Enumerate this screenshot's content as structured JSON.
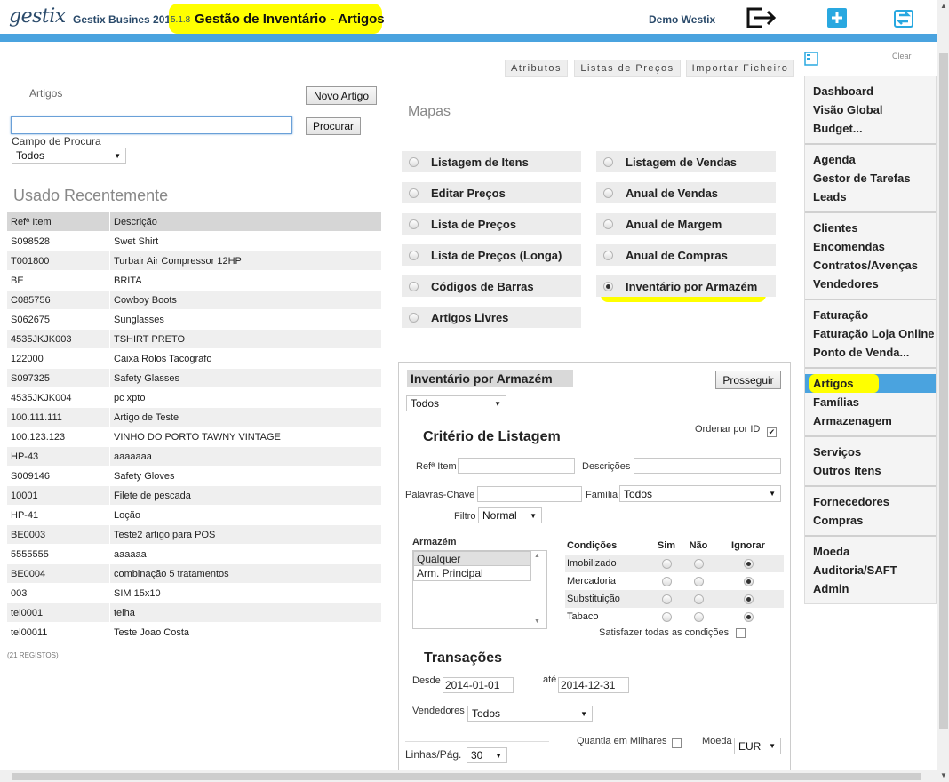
{
  "header": {
    "logo": "gestix",
    "app_name": "Gestix Busines 2014",
    "version": "5.1.8",
    "page_title": "Gestão de Inventário - Artigos",
    "user": "Demo Westix",
    "icons": [
      "logout-icon",
      "add-icon",
      "refresh-icon"
    ]
  },
  "tabs": [
    "Atributos",
    "Listas de Preços",
    "Importar Ficheiro"
  ],
  "search": {
    "section_label": "Artigos",
    "new_button": "Novo Artigo",
    "input_value": "",
    "search_button": "Procurar",
    "field_label": "Campo de Procura",
    "field_value": "Todos"
  },
  "recent": {
    "title": "Usado Recentemente",
    "columns": [
      "Refª Item",
      "Descrição"
    ],
    "rows": [
      [
        "S098528",
        "Swet Shirt"
      ],
      [
        "T001800",
        "Turbair Air Compressor 12HP"
      ],
      [
        "BE",
        "BRITA"
      ],
      [
        "C085756",
        "Cowboy Boots"
      ],
      [
        "S062675",
        "Sunglasses"
      ],
      [
        "4535JKJK003",
        "TSHIRT PRETO"
      ],
      [
        "122000",
        "Caixa Rolos Tacografo"
      ],
      [
        "S097325",
        "Safety Glasses"
      ],
      [
        "4535JKJK004",
        "pc xpto"
      ],
      [
        "100.111.111",
        "Artigo de Teste"
      ],
      [
        "100.123.123",
        "VINHO DO PORTO TAWNY VINTAGE"
      ],
      [
        "HP-43",
        "aaaaaaa"
      ],
      [
        "S009146",
        "Safety Gloves"
      ],
      [
        "10001",
        "Filete de pescada"
      ],
      [
        "HP-41",
        "Loção"
      ],
      [
        "BE0003",
        "Teste2 artigo para POS"
      ],
      [
        "5555555",
        "aaaaaa"
      ],
      [
        "BE0004",
        "combinação 5 tratamentos"
      ],
      [
        "003",
        "SIM 15x10"
      ],
      [
        "tel0001",
        "telha"
      ],
      [
        "tel00011",
        "Teste Joao Costa"
      ]
    ],
    "count_label": "(21 REGISTOS)"
  },
  "maps": {
    "title": "Mapas",
    "left": [
      "Listagem de Itens",
      "Editar Preços",
      "Lista de Preços",
      "Lista de Preços (Longa)",
      "Códigos de Barras",
      "Artigos Livres"
    ],
    "right": [
      "Listagem de Vendas",
      "Anual de Vendas",
      "Anual de Margem",
      "Anual de Compras",
      "Inventário por Armazém"
    ],
    "selected": "Inventário por Armazém"
  },
  "report": {
    "title": "Inventário por Armazém",
    "proceed_button": "Prosseguir",
    "scope_value": "Todos",
    "criteria_title": "Critério de Listagem",
    "order_by_id_label": "Ordenar por ID",
    "order_by_id_checked": true,
    "ref_label": "Refª Item",
    "desc_label": "Descrições",
    "keywords_label": "Palavras-Chave",
    "family_label": "Família",
    "family_value": "Todos",
    "filter_label": "Filtro",
    "filter_value": "Normal",
    "warehouse_label": "Armazém",
    "warehouses": [
      "Qualquer",
      "Arm. Principal"
    ],
    "conditions_label": "Condições",
    "cond_cols": [
      "Sim",
      "Não",
      "Ignorar"
    ],
    "conditions": [
      "Imobilizado",
      "Mercadoria",
      "Substituição",
      "Tabaco"
    ],
    "satisfy_all_label": "Satisfazer todas as condições",
    "transactions_title": "Transações",
    "from_label": "Desde",
    "from_value": "2014-01-01",
    "to_label": "até",
    "to_value": "2014-12-31",
    "sellers_label": "Vendedores",
    "sellers_value": "Todos",
    "thousands_label": "Quantia em Milhares",
    "currency_label": "Moeda",
    "currency_value": "EUR",
    "rows_label": "Linhas/Pág.",
    "rows_value": "30"
  },
  "sidebar": {
    "clear_label": "Clear",
    "groups": [
      [
        "Dashboard",
        "Visão Global",
        "Budget..."
      ],
      [
        "Agenda",
        "Gestor de Tarefas",
        "Leads"
      ],
      [
        "Clientes",
        "Encomendas",
        "Contratos/Avenças",
        "Vendedores"
      ],
      [
        "Faturação",
        "Faturação Loja Online",
        "Ponto de Venda..."
      ],
      [
        "Artigos",
        "Famílias",
        "Armazenagem"
      ],
      [
        "Serviços",
        "Outros Itens"
      ],
      [
        "Fornecedores",
        "Compras"
      ],
      [
        "Moeda",
        "Auditoria/SAFT",
        "Admin"
      ]
    ],
    "active": "Artigos"
  },
  "colors": {
    "accent": "#4aa3df",
    "highlight": "#ffff00",
    "brand": "#2a4a6a"
  }
}
